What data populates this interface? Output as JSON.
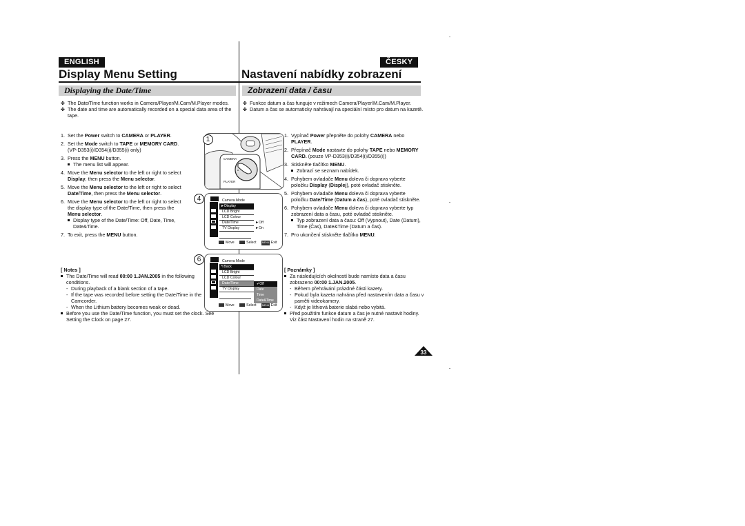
{
  "header": {
    "lang_en": "ENGLISH",
    "lang_cz": "ČESKY",
    "title_en": "Display Menu Setting",
    "title_cz": "Nastavení nabídky zobrazení",
    "subtitle_en": "Displaying the Date/Time",
    "subtitle_cz": "Zobrazení data / času"
  },
  "en": {
    "intro": [
      "The Date/Time function works in Camera/Player/M.Cam/M.Player modes.",
      "The date and time are automatically recorded on a special data area of the tape."
    ],
    "steps": [
      {
        "num": "1.",
        "html": "Set the <b>Power</b> switch to <b>CAMERA</b> or <b>PLAYER</b>."
      },
      {
        "num": "2.",
        "html": "Set the <b>Mode</b> switch to <b>TAPE</b> or <b>MEMORY CARD</b>.<br>(VP-D353(i)/D354(i)/D355(i) only)"
      },
      {
        "num": "3.",
        "html": "Press the <b>MENU</b> button.",
        "sub": "The menu list will appear."
      },
      {
        "num": "4.",
        "html": "Move the <b>Menu selector</b> to the left or right to select <b>Display</b>, then press the <b>Menu selector</b>."
      },
      {
        "num": "5.",
        "html": "Move the <b>Menu selector</b> to the left or right to select <b>Date/Time</b>, then press the <b>Menu selector</b>."
      },
      {
        "num": "6.",
        "html": "Move the <b>Menu selector</b> to the left or right to select the display type of the Date/Time, then press the <b>Menu selector</b>.",
        "sub": "Display type of the Date/Time: Off, Date, Time, Date&amp;Time."
      },
      {
        "num": "7.",
        "html": "To exit, press the <b>MENU</b> button."
      }
    ],
    "notes_title": "[ Notes ]",
    "notes": [
      {
        "html": "The Date/Time will read <b>00:00 1.JAN.2005</b> in the following conditions.",
        "dashes": [
          "During playback of a blank section of a tape.",
          "If the tape was recorded before setting the Date/Time in the Camcorder.",
          "When the Lithium battery becomes weak or dead."
        ]
      },
      {
        "html": "Before you use the Date/Time function, you must set the clock. See Setting the Clock on page 27.",
        "dashes": []
      }
    ]
  },
  "cz": {
    "intro": [
      "Funkce datum a čas funguje v režimech Camera/Player/M.Cam/M.Player.",
      "Datum a čas se automaticky nahrávají na speciální místo pro datum na kazetě."
    ],
    "steps": [
      {
        "num": "1.",
        "html": "Vypínač <b>Power</b> přepněte do polohy <b>CAMERA</b> nebo <b>PLAYER</b>."
      },
      {
        "num": "2.",
        "html": "Přepínač <b>Mode</b> nastavte do polohy <b>TAPE</b> nebo <b>MEMORY CARD.</b> (pouze VP-D353(i)/D354(i)/D355(i))"
      },
      {
        "num": "3.",
        "html": "Stiskněte tlačítko <b>MENU</b>.",
        "sub": "Zobrazí se seznam nabídek."
      },
      {
        "num": "4.",
        "html": "Pohybem ovladače <b>Menu</b> doleva či doprava vyberte položku <b>Display</b> (<b>Displej</b>), poté ovladač stiskněte."
      },
      {
        "num": "5.",
        "html": "Pohybem ovladače <b>Menu</b> doleva či doprava vyberte položku <b>Date/Time</b> (<b>Datum a čas</b>), poté ovladač stiskněte."
      },
      {
        "num": "6.",
        "html": "Pohybem ovladače <b>Menu</b> doleva či doprava vyberte typ zobrazení data a času, poté ovladač stiskněte.",
        "sub": "Typ zobrazení data a času: Off (Vypnout), Date (Datum), Time (Čas), Date&amp;Time (Datum a čas)."
      },
      {
        "num": "7.",
        "html": "Pro ukončení stiskněte tlačítko <b>MENU</b>."
      }
    ],
    "notes_title": "[ Poznámky ]",
    "notes": [
      {
        "html": "Za následujících okolností bude namísto data a času zobrazeno <b>00:00 1.JAN.2005</b>.",
        "dashes": [
          "Během přehrávání prázdné části kazety.",
          "Pokud byla kazeta nahrána před nastavením data a času v paměti videokamery.",
          "Když je lithiová baterie slabá nebo vybitá."
        ]
      },
      {
        "html": "Před použitím funkce datum a čas je nutné nastavit hodiny. Viz část Nastavení hodin na straně 27.",
        "dashes": []
      }
    ]
  },
  "figures": {
    "fig1": {
      "num": "1",
      "camera_label": "CAMERA",
      "player_label": "PLAYER"
    },
    "fig4": {
      "num": "4",
      "mode": "Camera Mode",
      "rows": [
        "►Display",
        "LCD Bright",
        "LCD Colour",
        "Date/Time",
        "TV Display"
      ],
      "values": [
        "►Off",
        "►On"
      ],
      "footer": {
        "move": "Move",
        "select": "Select",
        "menu": "MENU",
        "exit": "Exit"
      }
    },
    "fig6": {
      "num": "6",
      "mode": "Camera Mode",
      "rows": [
        "↰Back",
        "LCD Bright",
        "LCD Colour",
        "Date/Time",
        "TV Display"
      ],
      "options": [
        "✔Off",
        "Date",
        "Time",
        "Date&Time"
      ],
      "footer": {
        "move": "Move",
        "select": "Select",
        "menu": "MENU",
        "exit": "Exit"
      }
    }
  },
  "page_number": "33",
  "bullet_glyph": "✤"
}
